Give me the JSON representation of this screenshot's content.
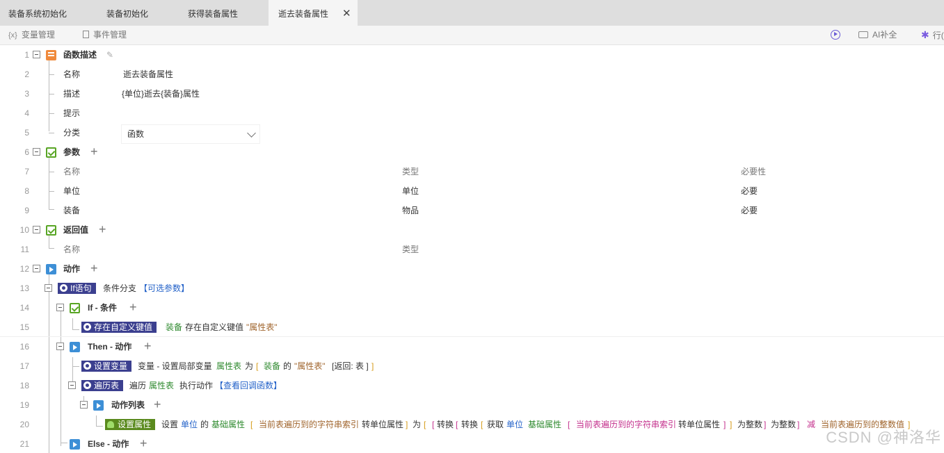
{
  "tabs": [
    {
      "label": "装备系统初始化"
    },
    {
      "label": "装备初始化"
    },
    {
      "label": "获得装备属性"
    },
    {
      "label": "逝去装备属性",
      "active": true
    }
  ],
  "tab_close": "✕",
  "toolbar": {
    "var_icon": "{x}",
    "var_label": "变量管理",
    "event_label": "事件管理",
    "ai_label": "AI补全",
    "more_label": "行("
  },
  "line_numbers": [
    "1",
    "2",
    "3",
    "4",
    "5",
    "6",
    "7",
    "8",
    "9",
    "10",
    "11",
    "12",
    "13",
    "14",
    "15",
    "16",
    "17",
    "18",
    "19",
    "20",
    "21"
  ],
  "desc": {
    "header": "函数描述",
    "name_label": "名称",
    "name_value": "逝去装备属性",
    "desc_label": "描述",
    "desc_value": "{单位}逝去{装备}属性",
    "hint_label": "提示",
    "category_label": "分类",
    "category_value": "函数"
  },
  "params": {
    "header": "参数",
    "col_name": "名称",
    "col_type": "类型",
    "col_required": "必要性",
    "rows": [
      {
        "name": "单位",
        "type": "单位",
        "required": "必要"
      },
      {
        "name": "装备",
        "type": "物品",
        "required": "必要"
      }
    ]
  },
  "returns": {
    "header": "返回值",
    "col_name": "名称",
    "col_type": "类型"
  },
  "actions": {
    "header": "动作",
    "if_badge": "If语句",
    "if_text": "条件分支",
    "if_link": "【可选参数】",
    "cond_header": "If - 条件",
    "cond_badge": "存在自定义键值",
    "cond_p1": "装备",
    "cond_p2": "存在自定义键值",
    "cond_p3": "\"属性表\"",
    "then_header": "Then - 动作",
    "setvar_badge": "设置变量",
    "setvar_p1": "变量 - 设置局部变量",
    "setvar_p2": "属性表",
    "setvar_p3": "为",
    "setvar_p4": "[",
    "setvar_p5": "装备",
    "setvar_p6": "的",
    "setvar_p7": "\"属性表\"",
    "setvar_p8": "[返回: 表 ]",
    "setvar_p9": "]",
    "loop_badge": "遍历表",
    "loop_p1": "遍历",
    "loop_p2": "属性表",
    "loop_p3": "执行动作",
    "loop_link": "【查看回调函数】",
    "list_header": "动作列表",
    "set_badge": "设置属性",
    "set_p1": "设置",
    "set_p2": "单位",
    "set_p3": "的",
    "set_p4": "基础属性",
    "set_p5": "[",
    "set_p6": "当前表遍历到的字符串索引",
    "set_p7": "转单位属性",
    "set_p8": "]",
    "set_p9": "为",
    "set_p10": "[",
    "set_p11": "[",
    "set_p12": "转换",
    "set_p13": "[",
    "set_p14": "转换",
    "set_p15": "[",
    "set_p16": "获取",
    "set_p17": "单位",
    "set_p18": "基础属性",
    "set_p19": "[",
    "set_p20": "当前表遍历到的字符串索引",
    "set_p21": "转单位属性",
    "set_p22": "]",
    "set_p23": "]",
    "set_p24": "为整数",
    "set_p25": "]",
    "set_p26": "为整数",
    "set_p27": "]",
    "set_p28": "减",
    "set_p29": "当前表遍历到的整数值",
    "set_p30": "]",
    "else_header": "Else - 动作"
  },
  "watermark": "CSDN @神洛华",
  "colors": {
    "tab_bar": "#dedede",
    "active_tab": "#f5f5f5",
    "badge_navy": "#3b3f8f",
    "badge_olive": "#5a8a1e",
    "keyword_blue": "#2563c9",
    "keyword_green": "#2f8a2f",
    "string_brown": "#a0652d",
    "bracket_gold": "#d69b17",
    "expr_pink": "#c4318d"
  },
  "icons": [
    "var-icon",
    "event-doc-icon",
    "run-icon",
    "robot-icon",
    "asterisk-icon",
    "pencil-icon",
    "function-icon",
    "checkbox-icon",
    "play-icon",
    "plus-icon",
    "collapse-icon",
    "chevron-down-icon",
    "close-icon"
  ]
}
